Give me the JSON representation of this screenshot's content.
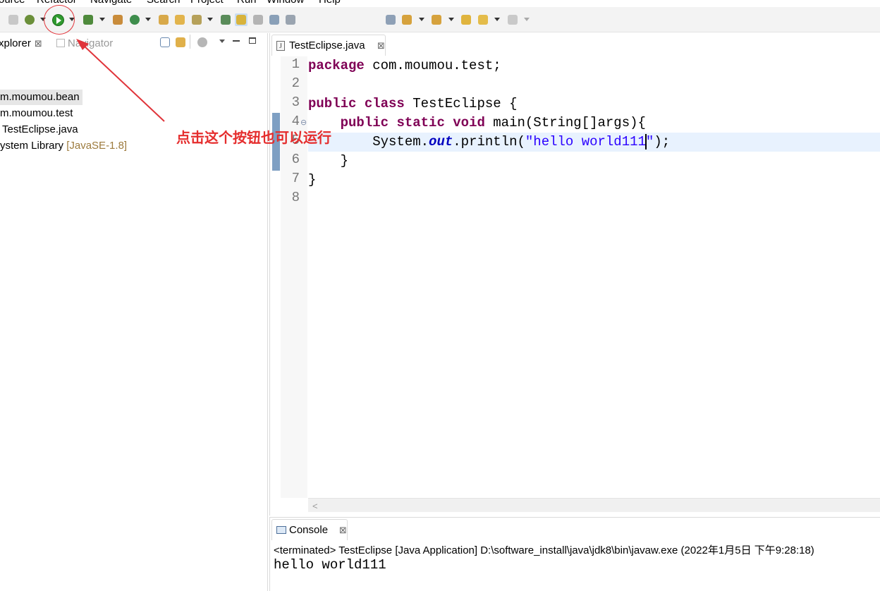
{
  "menu": {
    "items": [
      "ource",
      "Refactor",
      "Navigate",
      "Search",
      "Project",
      "Run",
      "Window",
      "Help"
    ]
  },
  "left_panel": {
    "tabs": [
      {
        "label": "xplorer",
        "active": true,
        "close": "⊠"
      },
      {
        "label": "Navigator",
        "active": false
      }
    ],
    "tree": [
      {
        "label": "m.moumou.bean",
        "selected": true
      },
      {
        "label": "m.moumou.test",
        "selected": false
      },
      {
        "label": "TestEclipse.java",
        "selected": false
      },
      {
        "label": "ystem Library",
        "suffix": "[JavaSE-1.8]",
        "selected": false
      }
    ]
  },
  "editor": {
    "tab_label": "TestEclipse.java",
    "tab_close": "⊠",
    "file_icon": "J",
    "line_numbers": [
      "1",
      "2",
      "3",
      "4",
      "5",
      "6",
      "7",
      "8"
    ],
    "fold_marker": "⊖",
    "lines": {
      "l1_kw": "package",
      "l1_rest": " com.moumou.test;",
      "l3_kw1": "public",
      "l3_kw2": "class",
      "l3_rest": " TestEclipse {",
      "l4_kw1": "public",
      "l4_kw2": "static",
      "l4_kw3": "void",
      "l4_rest": " main(String[]args){",
      "l5_pre": "System.",
      "l5_field": "out",
      "l5_mid": ".println(",
      "l5_str": "\"hello world111",
      "l5_str_end": "\"",
      "l5_end": ");",
      "l6": "}",
      "l7": "}"
    }
  },
  "console": {
    "tab_label": "Console",
    "tab_close": "⊠",
    "status": "<terminated> TestEclipse [Java Application] D:\\software_install\\java\\jdk8\\bin\\javaw.exe (2022年1月5日 下午9:28:18)",
    "output": "hello world111"
  },
  "annotation": {
    "text": "点击这个按钮也可以运行",
    "color": "#e52d2d"
  },
  "colors": {
    "keyword": "#7f0055",
    "string": "#2a00ff",
    "field": "#0000c0",
    "current_line": "#e8f2fe",
    "run_button": "#2f9a2f"
  }
}
